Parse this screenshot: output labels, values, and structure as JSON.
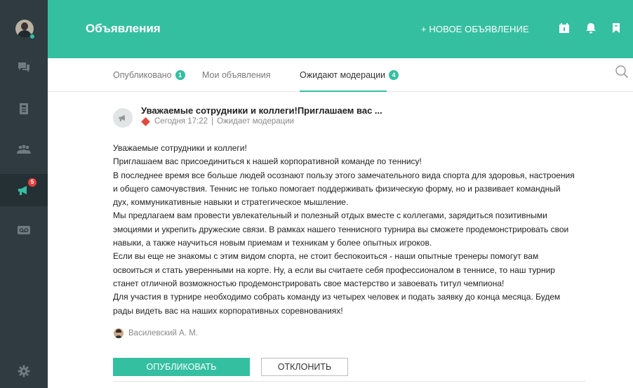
{
  "header": {
    "title": "Объявления",
    "new_announcement": "+ НОВОЕ ОБЪЯВЛЕНИЕ",
    "color": "#35bfa1"
  },
  "sidebar": {
    "messages_badge": "5",
    "items": [
      {
        "icon": "chat-icon"
      },
      {
        "icon": "contacts-icon"
      },
      {
        "icon": "groups-icon"
      },
      {
        "icon": "megaphone-icon",
        "active": true
      },
      {
        "icon": "voicemail-icon"
      },
      {
        "icon": "gear-icon"
      }
    ]
  },
  "tabs": [
    {
      "label": "Опубликовано",
      "count": "1"
    },
    {
      "label": "Мои объявления",
      "count": ""
    },
    {
      "label": "Ожидают модерации",
      "count": "4",
      "active": true
    }
  ],
  "post": {
    "title": "Уважаемые сотрудники и коллеги!Приглашаем вас ...",
    "time": "Сегодня 17:22",
    "separator": "|",
    "status": "Ожидает модерации",
    "body": [
      "Уважаемые сотрудники и коллеги!",
      "Приглашаем вас присоединиться к нашей корпоративной команде по теннису!",
      "В последнее время все больше людей осознают пользу этого замечательного вида спорта для здоровья, настроения",
      "и общего самочувствия. Теннис не только помогает поддерживать физическую форму, но и развивает командный",
      "дух, коммуникативные навыки и стратегическое мышление.",
      "Мы предлагаем вам провести увлекательный и полезный отдых вместе с коллегами, зарядиться позитивными",
      "эмоциями и укрепить дружеские связи. В рамках нашего теннисного турнира вы сможете продемонстрировать свои",
      "навыки, а также научиться новым приемам и техникам у более опытных игроков.",
      "Если вы еще не знакомы с этим видом спорта, не стоит беспокоиться - наши опытные тренеры помогут вам",
      "освоиться и стать уверенными на корте. Ну, а если вы считаете себя профессионалом в теннисе, то наш турнир",
      "станет отличной возможностью продемонстрировать свое мастерство и завоевать титул чемпиона!",
      "Для участия в турнире необходимо собрать команду из четырех человек и подать заявку до конца месяца. Будем",
      "рады видеть вас на наших корпоративных соревнованиях!"
    ],
    "author": "Василевский А. М."
  },
  "actions": {
    "publish": "ОПУБЛИКОВАТЬ",
    "decline": "ОТКЛОНИТЬ"
  }
}
